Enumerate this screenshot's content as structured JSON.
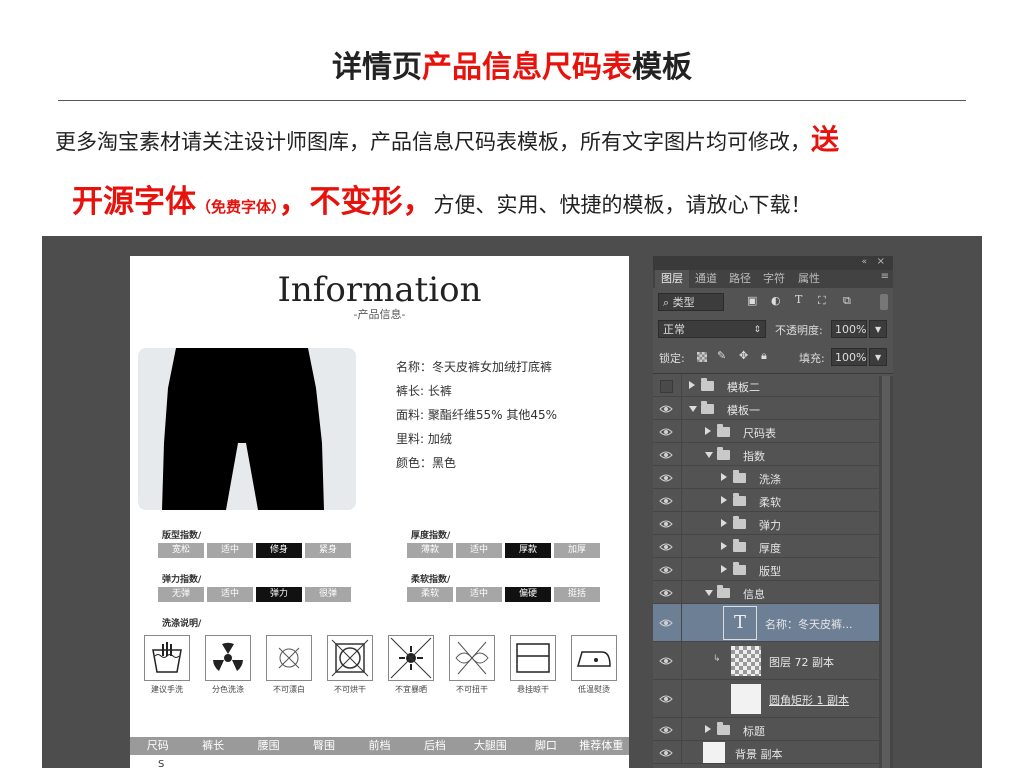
{
  "promo": {
    "title_prefix": "详情页",
    "title_highlight": "产品信息尺码表",
    "title_suffix": "模板",
    "line1_text": "更多淘宝素材请关注设计师图库，产品信息尺码表模板，所有文字图片均可修改，",
    "line1_highlight": "送",
    "line2_big1": "开源字体",
    "line2_small": "（免费字体）",
    "line2_big2": "，不变形，",
    "line2_rest": "方便、实用、快捷的模板，请放心下载！"
  },
  "document": {
    "title": "Information",
    "subtitle": "-产品信息-",
    "info": [
      "名称：冬天皮裤女加绒打底裤",
      "裤长: 长裤",
      "面料: 聚酯纤维55% 其他45%",
      "里料: 加绒",
      "颜色：黑色"
    ],
    "indexes": [
      {
        "label": "版型指数/",
        "options": [
          "宽松",
          "适中",
          "修身",
          "紧身"
        ],
        "selected": 2
      },
      {
        "label": "厚度指数/",
        "options": [
          "薄款",
          "适中",
          "厚款",
          "加厚"
        ],
        "selected": 2
      },
      {
        "label": "弹力指数/",
        "options": [
          "无弹",
          "适中",
          "弹力",
          "很弹"
        ],
        "selected": 2
      },
      {
        "label": "柔软指数/",
        "options": [
          "柔软",
          "适中",
          "偏硬",
          "挺括"
        ],
        "selected": 2
      }
    ],
    "care_title": "洗涤说明/",
    "care": [
      {
        "icon": "hand-wash-icon",
        "label": "建议手洗"
      },
      {
        "icon": "separate-wash-icon",
        "label": "分色洗涤"
      },
      {
        "icon": "no-bleach-icon",
        "label": "不可漂白"
      },
      {
        "icon": "no-tumble-dry-icon",
        "label": "不可烘干"
      },
      {
        "icon": "no-sun-icon",
        "label": "不宜暴晒"
      },
      {
        "icon": "no-wring-icon",
        "label": "不可扭干"
      },
      {
        "icon": "hang-dry-icon",
        "label": "悬挂晾干"
      },
      {
        "icon": "low-iron-icon",
        "label": "低温熨烫"
      }
    ],
    "size_columns": [
      "尺码",
      "裤长",
      "腰围",
      "臀围",
      "前档",
      "后档",
      "大腿围",
      "脚口",
      "推荐体重"
    ]
  },
  "panel": {
    "tabs": [
      "图层",
      "通道",
      "路径",
      "字符",
      "属性"
    ],
    "active_tab": 0,
    "filter_label": "类型",
    "blend_mode": "正常",
    "opacity_label": "不透明度:",
    "opacity_value": "100%",
    "lock_label": "锁定:",
    "fill_label": "填充:",
    "fill_value": "100%",
    "layers": [
      {
        "name": "模板二",
        "type": "folder",
        "level": 0,
        "expanded": false,
        "visible": false
      },
      {
        "name": "模板一",
        "type": "folder",
        "level": 0,
        "expanded": true,
        "visible": true
      },
      {
        "name": "尺码表",
        "type": "folder",
        "level": 1,
        "expanded": false,
        "visible": true
      },
      {
        "name": "指数",
        "type": "folder",
        "level": 1,
        "expanded": true,
        "visible": true
      },
      {
        "name": "洗涤",
        "type": "folder",
        "level": 2,
        "expanded": false,
        "visible": true
      },
      {
        "name": "柔软",
        "type": "folder",
        "level": 2,
        "expanded": false,
        "visible": true
      },
      {
        "name": "弹力",
        "type": "folder",
        "level": 2,
        "expanded": false,
        "visible": true
      },
      {
        "name": "厚度",
        "type": "folder",
        "level": 2,
        "expanded": false,
        "visible": true
      },
      {
        "name": "版型",
        "type": "folder",
        "level": 2,
        "expanded": false,
        "visible": true
      },
      {
        "name": "信息",
        "type": "folder",
        "level": 1,
        "expanded": true,
        "visible": true
      },
      {
        "name": "名称：冬天皮裤...",
        "type": "text",
        "level": 2,
        "visible": true,
        "selected": true
      },
      {
        "name": "图层 72 副本",
        "type": "image",
        "level": 2,
        "visible": true
      },
      {
        "name": "圆角矩形 1 副本",
        "type": "shape",
        "level": 2,
        "visible": true
      },
      {
        "name": "标题",
        "type": "folder",
        "level": 1,
        "expanded": false,
        "visible": true
      },
      {
        "name": "背景 副本",
        "type": "image",
        "level": 0,
        "visible": true
      }
    ]
  },
  "colors": {
    "accent_red": "#e8120c",
    "chip_off": "#a6a6a6",
    "chip_on": "#111111",
    "panel_bg": "#535353",
    "selected_layer": "#6d7f95"
  }
}
